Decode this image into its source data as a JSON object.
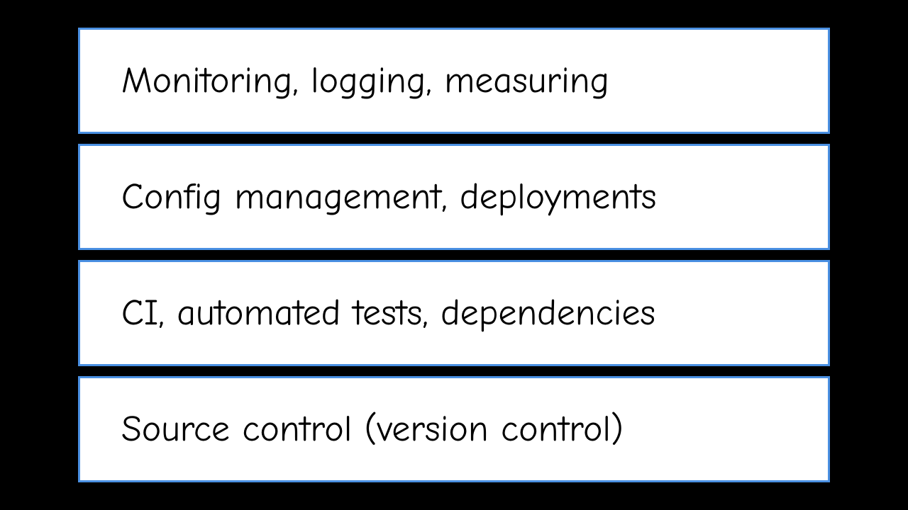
{
  "layers": [
    {
      "label": "Monitoring, logging, measuring"
    },
    {
      "label": "Config management, deployments"
    },
    {
      "label": "CI, automated tests, dependencies"
    },
    {
      "label": "Source control (version control)"
    }
  ],
  "colors": {
    "background": "#000000",
    "box_background": "#ffffff",
    "box_border": "#4a90e2",
    "text": "#000000"
  }
}
